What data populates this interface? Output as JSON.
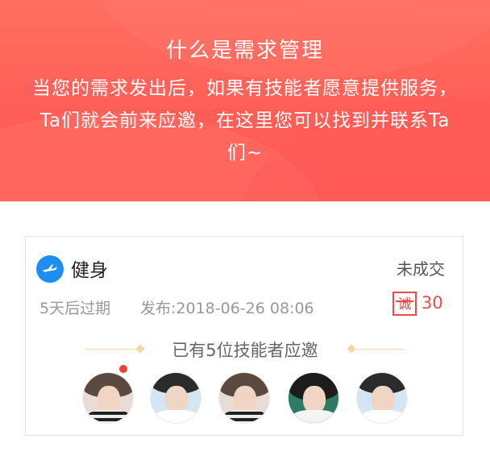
{
  "banner": {
    "title": "什么是需求管理",
    "description": "当您的需求发出后，如果有技能者愿意提供服务，Ta们就会前来应邀，在这里您可以找到并联系Ta们~"
  },
  "demand": {
    "category_icon": "airplane-icon",
    "category": "健身",
    "status": "未成交",
    "expire_text": "5天后过期",
    "published_label": "发布:",
    "published_time": "2018-06-26 08:06",
    "credit_icon_text": "诚",
    "credit_value": "30",
    "invite_text": "已有5位技能者应邀"
  },
  "colors": {
    "banner": "#ff5e57",
    "accent_red": "#ef4b4b",
    "category_blue": "#1f8ef1",
    "decor_line": "#f4d7a3"
  }
}
